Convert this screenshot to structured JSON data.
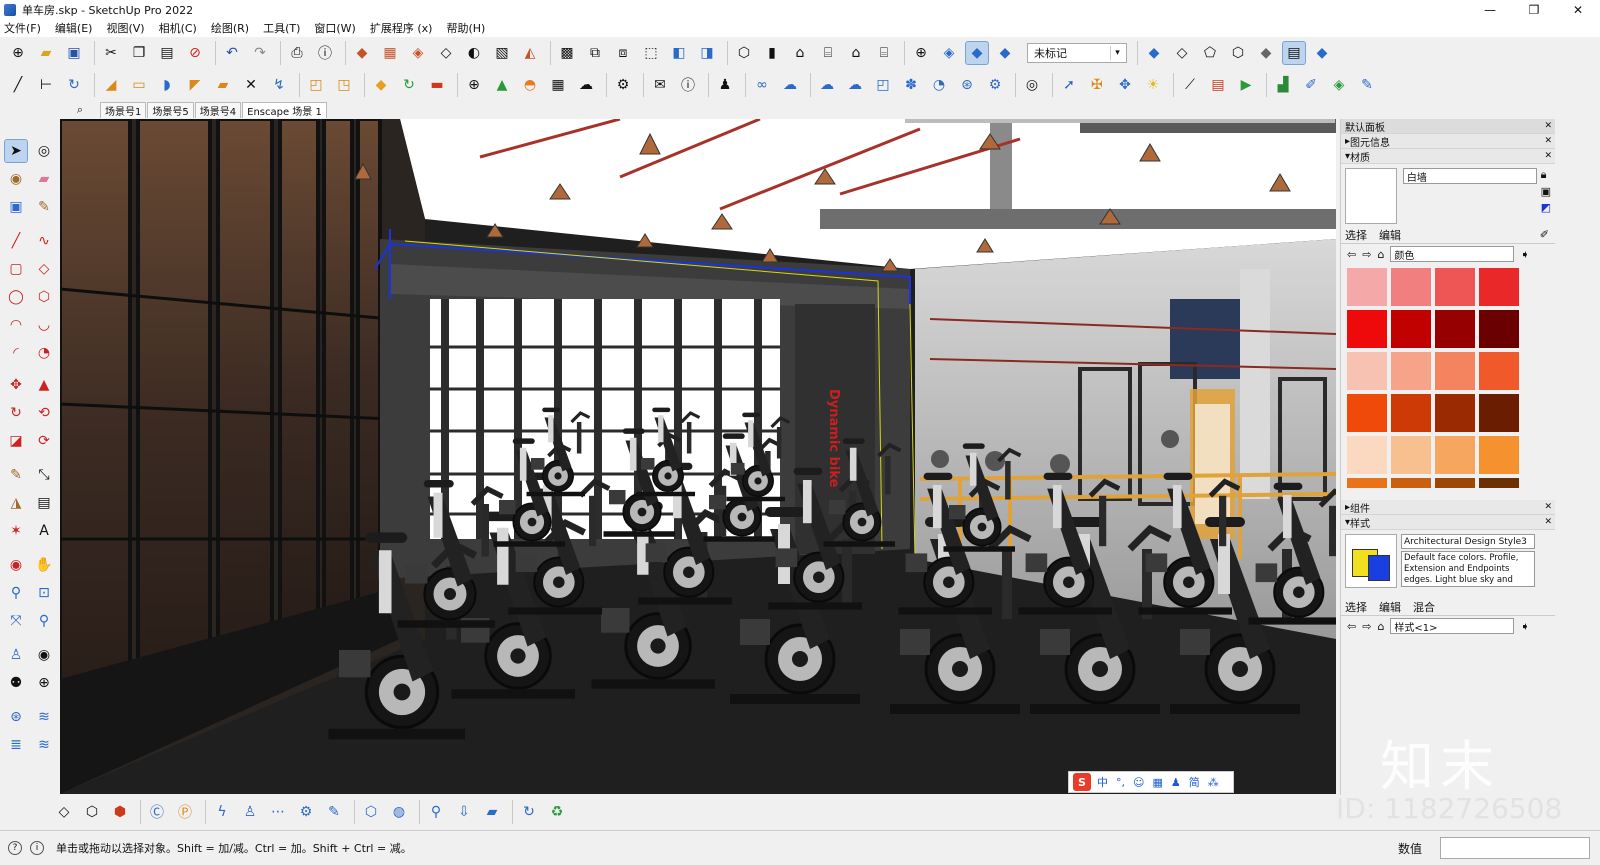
{
  "window": {
    "title": "单车房.skp - SketchUp Pro 2022",
    "minimize": "—",
    "maximize": "❐",
    "close": "✕"
  },
  "menu": [
    "文件(F)",
    "编辑(E)",
    "视图(V)",
    "相机(C)",
    "绘图(R)",
    "工具(T)",
    "窗口(W)",
    "扩展程序 (x)",
    "帮助(H)"
  ],
  "toolbar": {
    "tag_value": "未标记"
  },
  "scenes": {
    "tabs": [
      "场景号1",
      "场景号5",
      "场景号4",
      "Enscape 场景 1"
    ],
    "active_index": 3
  },
  "viewport": {
    "wall_text": "Dynamic bike"
  },
  "panel": {
    "title": "默认面板",
    "entity_info": "图元信息",
    "materials": "材质",
    "material_name": "白墙",
    "tab_select": "选择",
    "tab_edit": "编辑",
    "library": "颜色",
    "swatches": [
      "#f4a9a8",
      "#f17f7f",
      "#ee5555",
      "#e9282a",
      "#ee0a0a",
      "#c10000",
      "#960000",
      "#6a0000",
      "#f8c2b3",
      "#f6a38a",
      "#f4835f",
      "#f05a2a",
      "#f04a0a",
      "#cd3a06",
      "#9a2a02",
      "#6a1d01",
      "#fbd9c0",
      "#f9c08f",
      "#f7a65f",
      "#f5912e",
      "#e8731a",
      "#c95f10",
      "#9b4708",
      "#6b3003"
    ],
    "components": "组件",
    "styles": "样式",
    "style_name": "Architectural Design Style3",
    "style_desc": "Default face colors. Profile, Extension and Endpoints edges. Light blue sky and gray",
    "style_tab_select": "选择",
    "style_tab_edit": "编辑",
    "style_tab_mix": "混合",
    "style_combo": "样式<1>"
  },
  "ime": {
    "items": [
      "中",
      "°,",
      "☺",
      "▦",
      "♟",
      "简",
      "⁂"
    ]
  },
  "status": {
    "hint": "单击或拖动以选择对象。Shift = 加/减。Ctrl = 加。Shift + Ctrl = 减。",
    "measurements_label": "数值"
  },
  "watermark": {
    "logo": "知末",
    "id": "ID: 1182726508"
  },
  "colors": {
    "accent": "#3a7bd5",
    "ceiling": "#ffffff",
    "dark_wall": "#2b2b2b",
    "accent_red": "#c8201e",
    "rail_orange": "#e0a23a"
  }
}
